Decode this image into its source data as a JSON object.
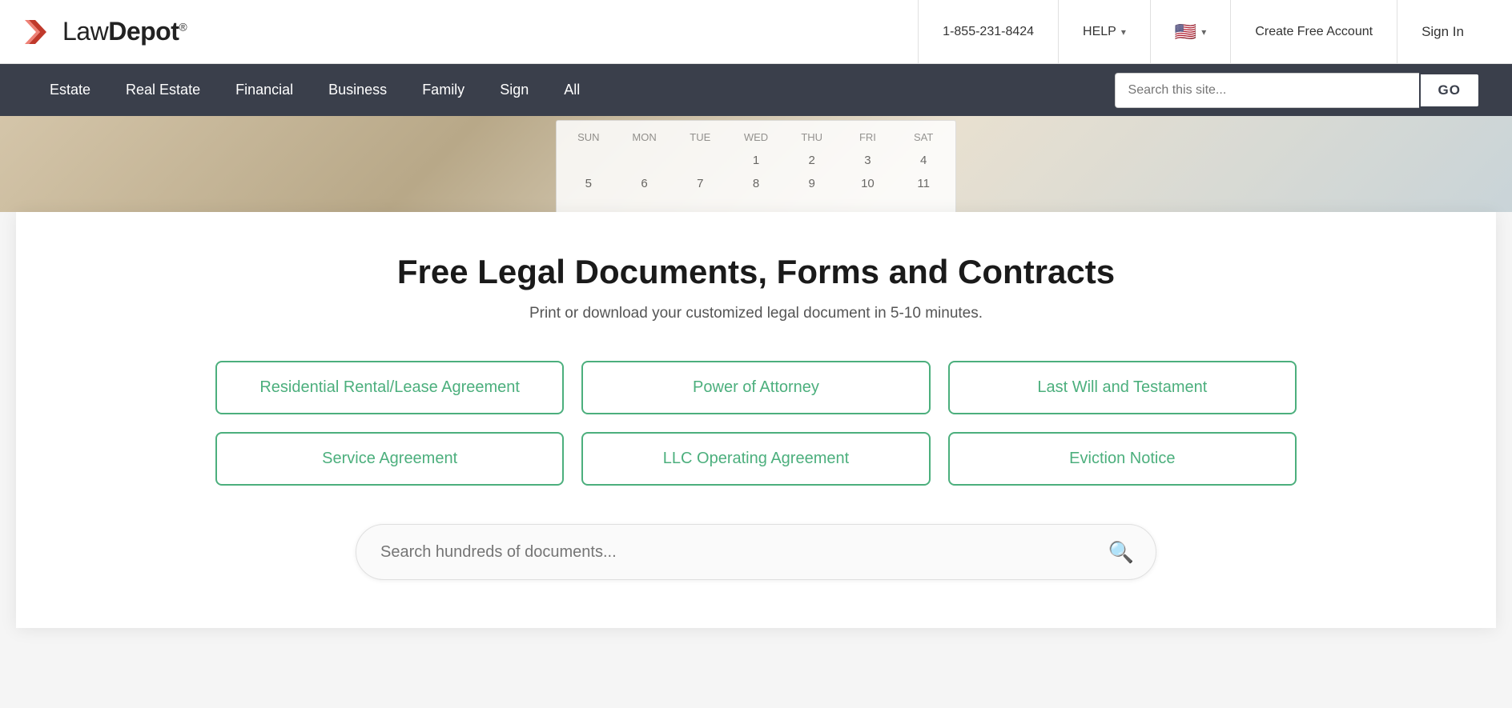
{
  "header": {
    "logo_text_regular": "Law",
    "logo_text_bold": "Depot",
    "logo_trademark": "®",
    "phone": "1-855-231-8424",
    "help_label": "HELP",
    "create_account_label": "Create Free Account",
    "sign_in_label": "Sign In"
  },
  "nav": {
    "links": [
      {
        "label": "Estate",
        "id": "estate"
      },
      {
        "label": "Real Estate",
        "id": "real-estate"
      },
      {
        "label": "Financial",
        "id": "financial"
      },
      {
        "label": "Business",
        "id": "business"
      },
      {
        "label": "Family",
        "id": "family"
      },
      {
        "label": "Sign",
        "id": "sign"
      },
      {
        "label": "All",
        "id": "all"
      }
    ],
    "search_placeholder": "Search this site...",
    "search_button_label": "GO"
  },
  "hero": {
    "calendar_days": [
      "SUN",
      "MON",
      "TUE",
      "WED",
      "THU",
      "FRI",
      "SAT"
    ],
    "calendar_numbers": [
      "",
      "",
      "",
      "1",
      "2",
      "3",
      "4",
      "5",
      "6",
      "7",
      "8",
      "9",
      "10",
      "11"
    ]
  },
  "main": {
    "title": "Free Legal Documents, Forms and Contracts",
    "subtitle": "Print or download your customized legal document in 5-10 minutes.",
    "doc_buttons": [
      [
        {
          "label": "Residential Rental/Lease Agreement",
          "id": "rental"
        },
        {
          "label": "Power of Attorney",
          "id": "poa"
        },
        {
          "label": "Last Will and Testament",
          "id": "will"
        }
      ],
      [
        {
          "label": "Service Agreement",
          "id": "service"
        },
        {
          "label": "LLC Operating Agreement",
          "id": "llc"
        },
        {
          "label": "Eviction Notice",
          "id": "eviction"
        }
      ]
    ],
    "search_placeholder": "Search hundreds of documents..."
  }
}
